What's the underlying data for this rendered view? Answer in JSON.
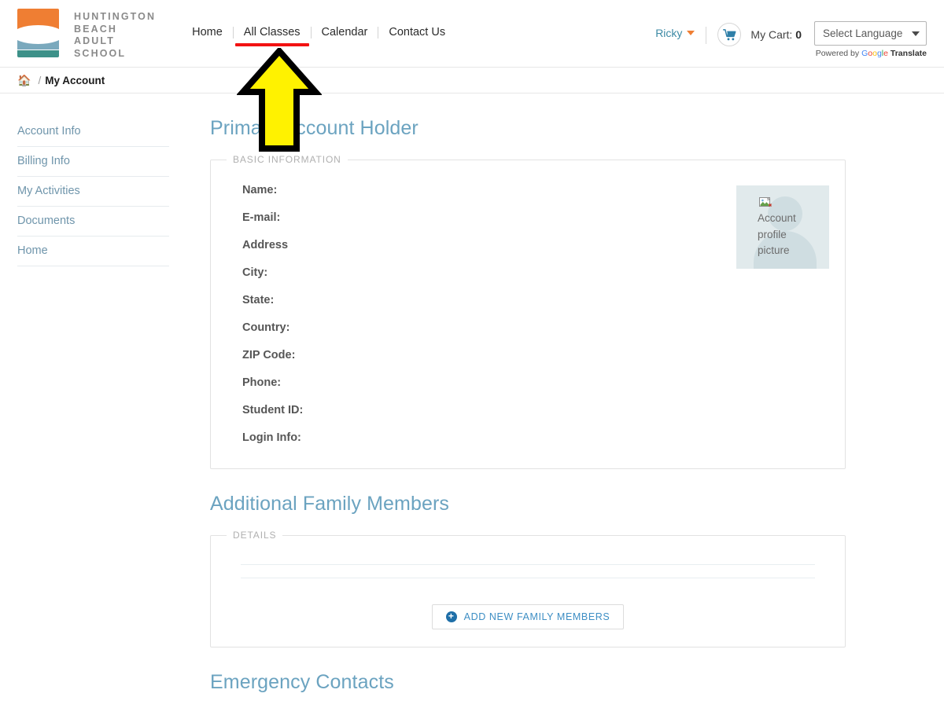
{
  "header": {
    "logo": {
      "icon": "huntington-beach-logo",
      "lines": [
        "HUNTINGTON",
        "BEACH",
        "ADULT",
        "SCHOOL"
      ],
      "colors": {
        "top": "#ef7e33",
        "middle": "#7aa9bd",
        "bottom": "#3d9189"
      }
    },
    "nav": [
      {
        "label": "Home",
        "active": false
      },
      {
        "label": "All Classes",
        "active": true
      },
      {
        "label": "Calendar",
        "active": false
      },
      {
        "label": "Contact Us",
        "active": false
      }
    ],
    "user": {
      "name": "Ricky",
      "caret": "caret-down-icon"
    },
    "cart": {
      "icon": "shopping-cart-icon",
      "label": "My Cart:",
      "count": "0"
    },
    "language": {
      "selected": "Select Language",
      "powered_prefix": "Powered by",
      "google_letters": [
        "G",
        "o",
        "o",
        "g",
        "l",
        "e"
      ],
      "translate": "Translate"
    }
  },
  "breadcrumb": {
    "home_icon": "home-icon",
    "separator": "/",
    "current": "My Account"
  },
  "sidebar": {
    "items": [
      {
        "label": "Account Info"
      },
      {
        "label": "Billing Info"
      },
      {
        "label": "My Activities"
      },
      {
        "label": "Documents"
      },
      {
        "label": "Home"
      }
    ]
  },
  "main": {
    "primary_account": {
      "title": "Primary Account Holder",
      "legend": "BASIC INFORMATION",
      "fields": [
        {
          "label": "Name:",
          "value": ""
        },
        {
          "label": "E-mail:",
          "value": ""
        },
        {
          "label": "Address",
          "value": ""
        },
        {
          "label": "City:",
          "value": ""
        },
        {
          "label": "State:",
          "value": ""
        },
        {
          "label": "Country:",
          "value": ""
        },
        {
          "label": "ZIP Code:",
          "value": ""
        },
        {
          "label": "Phone:",
          "value": ""
        },
        {
          "label": "Student ID:",
          "value": ""
        },
        {
          "label": "Login Info:",
          "value": ""
        }
      ],
      "avatar": {
        "alt_text": "Account profile picture",
        "icon": "broken-image-icon"
      }
    },
    "family_members": {
      "title": "Additional Family Members",
      "legend": "DETAILS",
      "add_button": {
        "icon": "plus-circle-icon",
        "label": "ADD NEW FAMILY MEMBERS"
      }
    },
    "emergency_contacts": {
      "title": "Emergency Contacts"
    }
  },
  "annotations": {
    "arrow": {
      "color": "#FFF200",
      "outline": "#000000",
      "points_to": "All Classes"
    },
    "underline": {
      "color": "#f21212",
      "target": "All Classes"
    }
  }
}
